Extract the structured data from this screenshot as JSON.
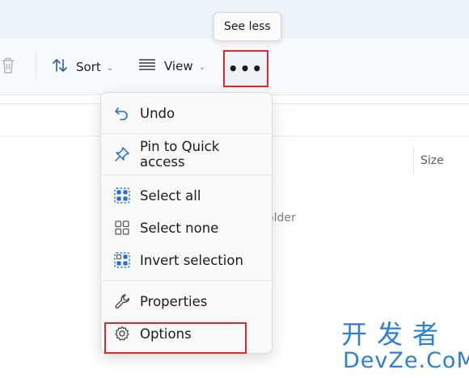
{
  "tooltip": {
    "text": "See less"
  },
  "toolbar": {
    "sort_label": "Sort",
    "view_label": "View",
    "more_label": "•••"
  },
  "file_list": {
    "size_header": "Size",
    "empty_text": "older"
  },
  "menu": {
    "items": [
      {
        "label": "Undo",
        "icon": "undo-icon"
      },
      {
        "label": "Pin to Quick access",
        "icon": "pin-icon"
      },
      {
        "label": "Select all",
        "icon": "select-all-icon"
      },
      {
        "label": "Select none",
        "icon": "select-none-icon"
      },
      {
        "label": "Invert selection",
        "icon": "invert-selection-icon"
      },
      {
        "label": "Properties",
        "icon": "wrench-icon"
      },
      {
        "label": "Options",
        "icon": "gear-icon"
      }
    ]
  },
  "watermark": {
    "line1": "开发者",
    "line2": "DevZe.CoM"
  },
  "colors": {
    "accent": "#1a6fd6",
    "highlight_box": "#d52b2b",
    "watermark": "#2b7fd8"
  }
}
